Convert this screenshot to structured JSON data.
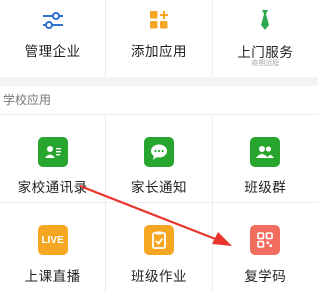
{
  "top_row": [
    {
      "label": "管理企业",
      "icon": "sliders-icon"
    },
    {
      "label": "添加应用",
      "icon": "add-apps-icon"
    },
    {
      "label": "上门服务",
      "sub": "疫期远程",
      "icon": "tie-icon"
    }
  ],
  "section": {
    "title": "学校应用"
  },
  "apps_row1": [
    {
      "label": "家校通讯录",
      "icon": "contact-card-icon"
    },
    {
      "label": "家长通知",
      "icon": "chat-bubble-icon"
    },
    {
      "label": "班级群",
      "icon": "group-icon"
    }
  ],
  "apps_row2": [
    {
      "label": "上课直播",
      "icon": "live-icon",
      "icon_text": "LIVE"
    },
    {
      "label": "班级作业",
      "icon": "homework-icon"
    },
    {
      "label": "复学码",
      "icon": "qr-code-icon"
    }
  ],
  "colors": {
    "green": "#27a52f",
    "orange": "#f5a623",
    "red": "#f26d60",
    "top_icon_blue": "#2f6fd1",
    "top_icon_orange": "#f5a623",
    "top_icon_green": "#2fa84f",
    "annotation_arrow": "#e8362c"
  }
}
